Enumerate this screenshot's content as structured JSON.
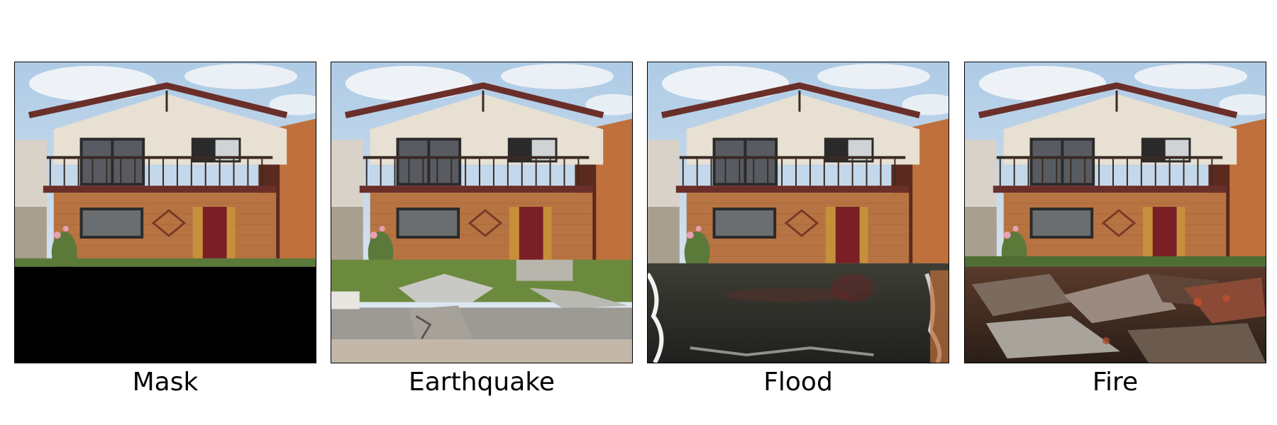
{
  "panels": [
    {
      "label": "Mask",
      "scene": "house-with-masked-ground"
    },
    {
      "label": "Earthquake",
      "scene": "house-with-cracked-sidewalk-debris"
    },
    {
      "label": "Flood",
      "scene": "house-with-flood-water"
    },
    {
      "label": "Fire",
      "scene": "house-with-burnt-debris"
    }
  ],
  "colors": {
    "sky": "#c9d9ea",
    "stucco": "#e8e0d2",
    "roof_trim": "#6b2f2a",
    "brick": "#b77442",
    "door": "#7a1f26",
    "mask": "#000000",
    "flood_water": "#2b2f2a",
    "burnt": "#3a2a22"
  }
}
